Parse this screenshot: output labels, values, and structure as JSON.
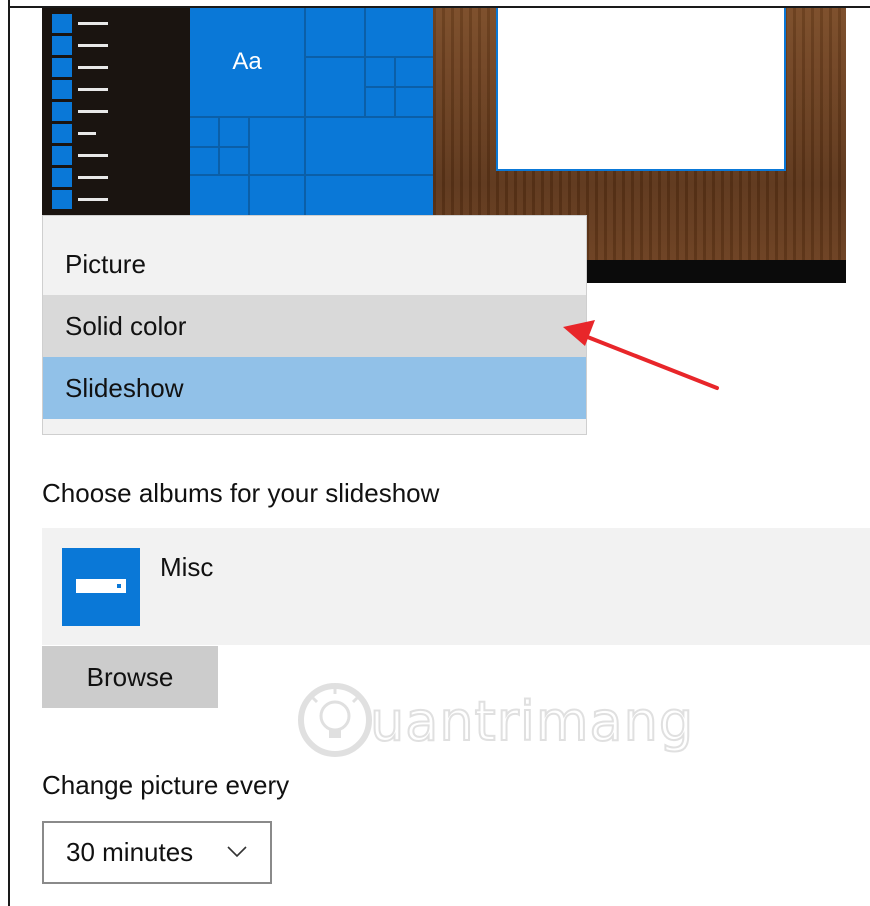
{
  "preview": {
    "tile_label": "Aa"
  },
  "background_dropdown": {
    "options": [
      "Picture",
      "Solid color",
      "Slideshow"
    ],
    "selected": "Slideshow",
    "hovered": "Solid color"
  },
  "albums": {
    "heading": "Choose albums for your slideshow",
    "items": [
      {
        "name": "Misc",
        "icon": "folder-icon"
      }
    ],
    "browse_label": "Browse"
  },
  "interval": {
    "heading": "Change picture every",
    "value": "30 minutes"
  },
  "watermark": {
    "text": "uantrimang"
  },
  "colors": {
    "accent": "#0a78d7",
    "selected_item": "#91c1e8",
    "hover_item": "#d9d9d9",
    "annotation_arrow": "#e8262a"
  }
}
